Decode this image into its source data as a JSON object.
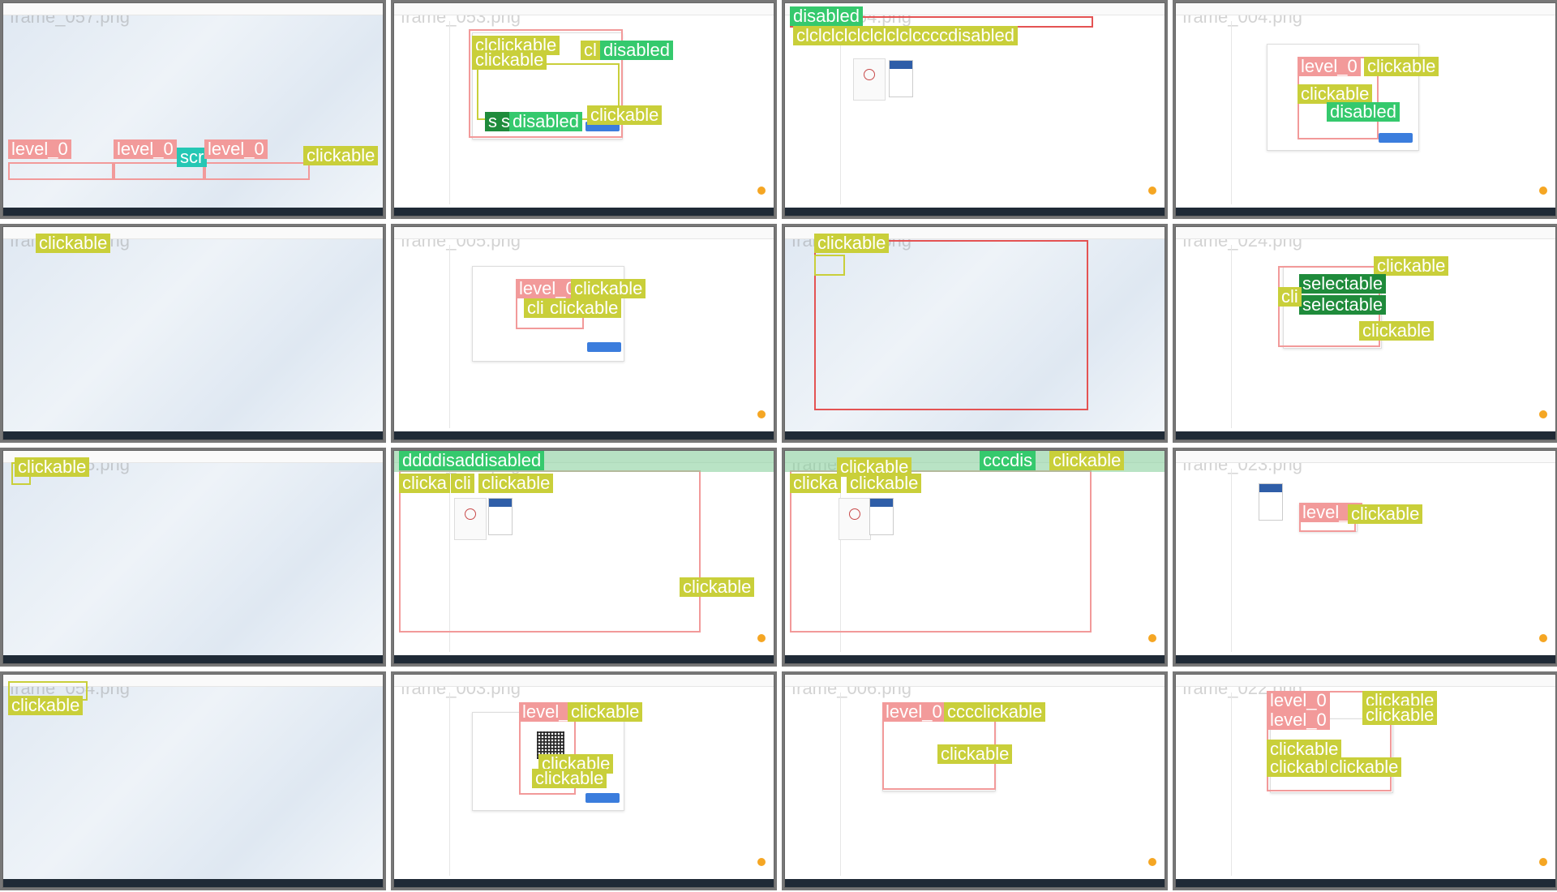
{
  "page": {
    "background": "#ffffff"
  },
  "tiles": [
    {
      "id": "frame_057",
      "filename": "frame_057.png",
      "mode": "desktop",
      "labels": {
        "a": "level_0",
        "b": "level_0",
        "c": "level_0",
        "d": "scr",
        "e": "clickable"
      }
    },
    {
      "id": "frame_053",
      "filename": "frame_053.png",
      "mode": "app",
      "labels": {
        "a": "clclickable",
        "b": "clickable",
        "c": "cl",
        "d": "disabled",
        "e": "disabled",
        "f": "clickable",
        "g": "s",
        "h": "s"
      }
    },
    {
      "id": "frame_054",
      "filename": "frame_054.png",
      "mode": "app",
      "labels": {
        "a": "disabled",
        "b": "clclclclclclclclclccccdisabled"
      }
    },
    {
      "id": "frame_004",
      "filename": "frame_004.png",
      "mode": "app",
      "labels": {
        "a": "level_0",
        "b": "clickable",
        "c": "clickable",
        "d": "disabled"
      }
    },
    {
      "id": "frame_058",
      "filename": "frame_058.png",
      "mode": "desktop",
      "labels": {
        "a": "clickable"
      }
    },
    {
      "id": "frame_005",
      "filename": "frame_005.png",
      "mode": "app",
      "labels": {
        "a": "level_0",
        "b": "clickable",
        "c": "clickable",
        "d": "cli"
      }
    },
    {
      "id": "frame_059",
      "filename": "frame_059.png",
      "mode": "desktop",
      "labels": {
        "a": "clickable"
      }
    },
    {
      "id": "frame_024",
      "filename": "frame_024.png",
      "mode": "app",
      "labels": {
        "a": "clickable",
        "b": "selectable",
        "c": "selectable",
        "d": "clickable",
        "e": "cli"
      }
    },
    {
      "id": "frame_055",
      "filename": "frame_055.png",
      "mode": "desktop",
      "labels": {
        "a": "clickable"
      }
    },
    {
      "id": "frame_001",
      "filename": "frame_001.png",
      "mode": "app",
      "labels": {
        "a": "ddddisaddisabled",
        "b": "clicka",
        "c": "clickable",
        "d": "clickable",
        "e": "cli"
      }
    },
    {
      "id": "frame_002",
      "filename": "frame_002.png",
      "mode": "app",
      "labels": {
        "a": "clickable",
        "b": "clicka",
        "c": "clickable",
        "d": "cccdis",
        "e": "clickable"
      }
    },
    {
      "id": "frame_023",
      "filename": "frame_023.png",
      "mode": "app",
      "labels": {
        "a": "level_0",
        "b": "clickable"
      }
    },
    {
      "id": "frame_054b",
      "filename": "frame_054.png",
      "mode": "desktop",
      "labels": {
        "a": "clickable"
      }
    },
    {
      "id": "frame_003",
      "filename": "frame_003.png",
      "mode": "app",
      "labels": {
        "a": "level_0",
        "b": "clickable",
        "c": "clickable",
        "d": "clickable"
      }
    },
    {
      "id": "frame_006",
      "filename": "frame_006.png",
      "mode": "app",
      "labels": {
        "a": "level_0",
        "b": "cccclickable",
        "c": "clickable"
      }
    },
    {
      "id": "frame_022",
      "filename": "frame_022.png",
      "mode": "app",
      "labels": {
        "a": "level_0",
        "b": "level_0",
        "c": "clickable",
        "d": "clickable",
        "e": "clickable",
        "f": "clickable",
        "g": "clickable"
      }
    }
  ]
}
